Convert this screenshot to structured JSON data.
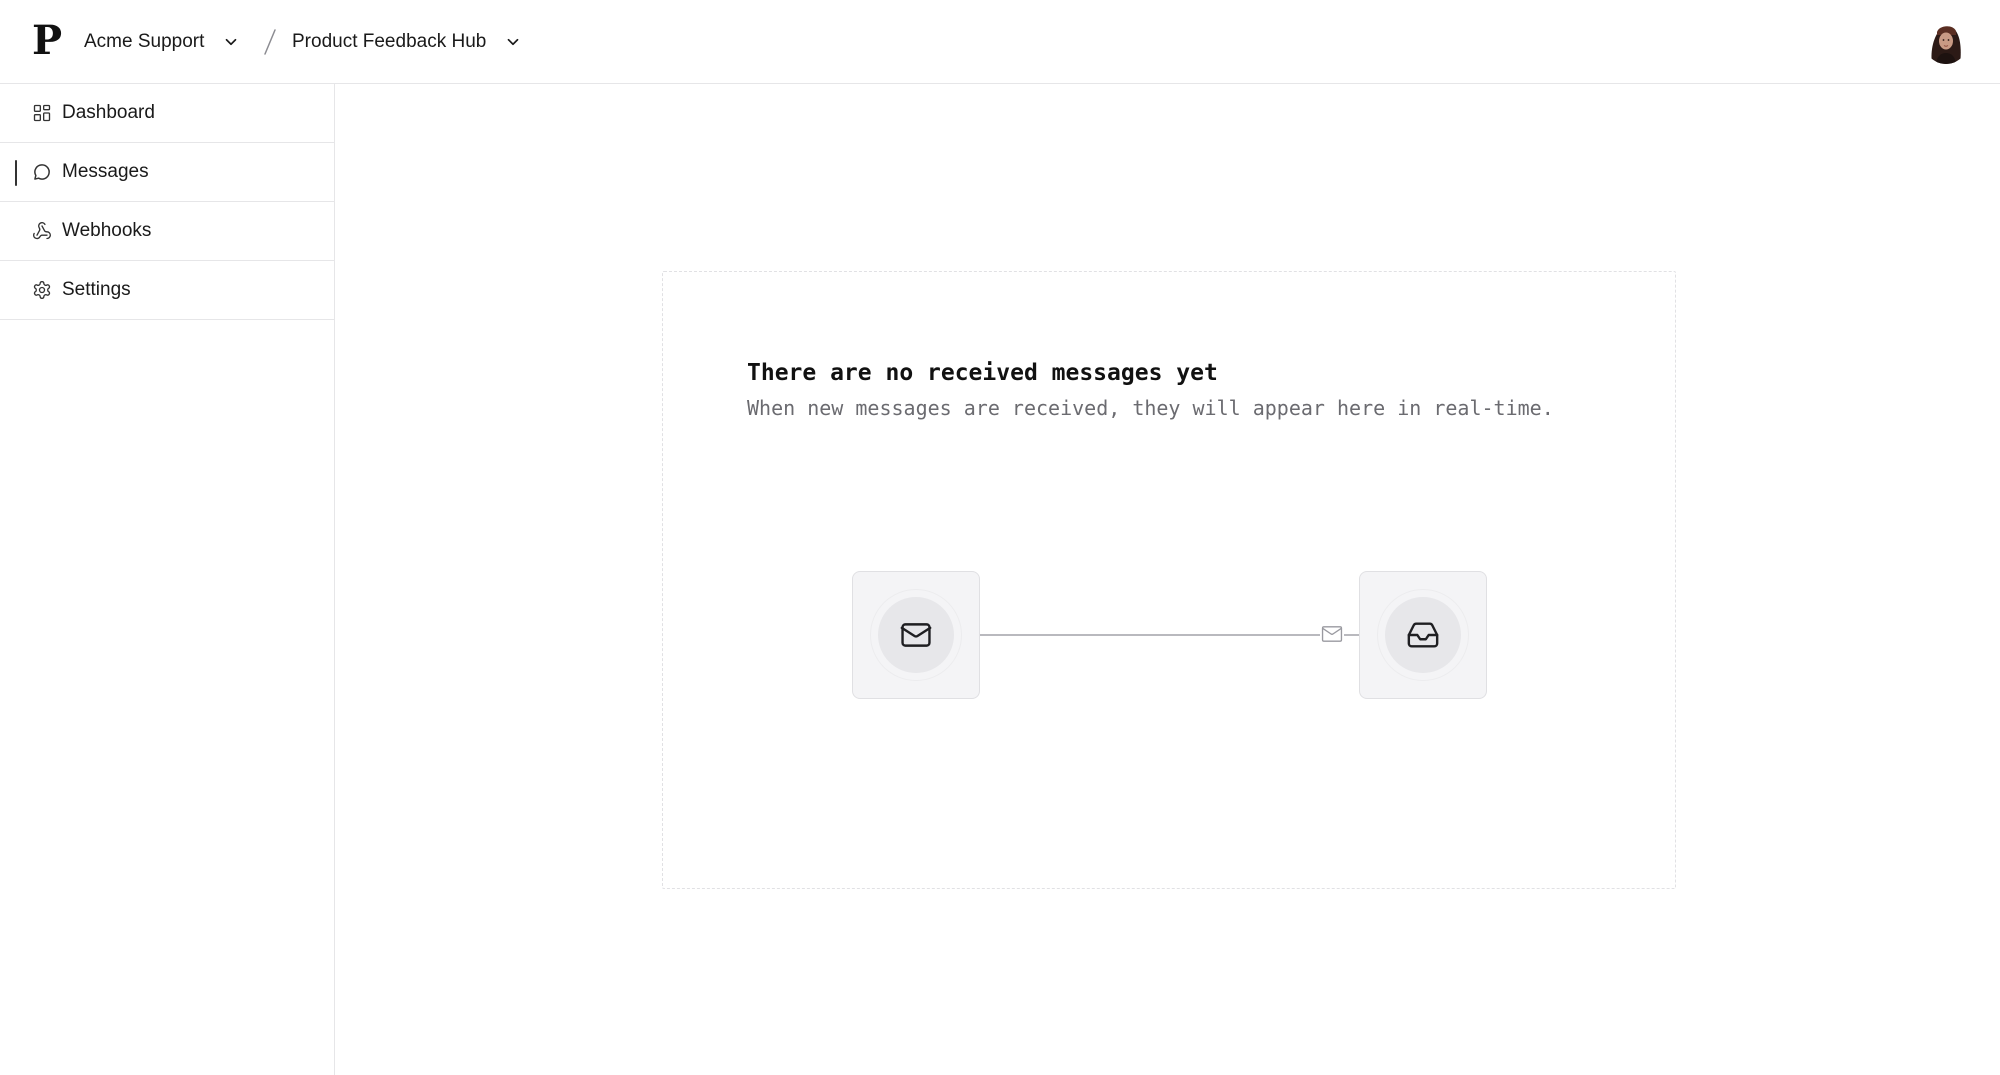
{
  "header": {
    "logo_text": "P",
    "organization": "Acme Support",
    "project": "Product Feedback Hub"
  },
  "sidebar": {
    "items": [
      {
        "label": "Dashboard",
        "icon": "dashboard-grid-icon",
        "active": false
      },
      {
        "label": "Messages",
        "icon": "message-bubble-icon",
        "active": true
      },
      {
        "label": "Webhooks",
        "icon": "webhook-icon",
        "active": false
      },
      {
        "label": "Settings",
        "icon": "gear-icon",
        "active": false
      }
    ]
  },
  "empty_state": {
    "title": "There are no received messages yet",
    "subtitle": "When new messages are received, they will appear here in real-time.",
    "sender_icon": "envelope-icon",
    "packet_icon": "envelope-icon",
    "receiver_icon": "inbox-icon"
  },
  "colors": {
    "border": "#e6e6e8",
    "text": "#111111",
    "muted_text": "#6b6b70",
    "node_bg": "#f4f4f6",
    "connector": "#b9b9be"
  }
}
